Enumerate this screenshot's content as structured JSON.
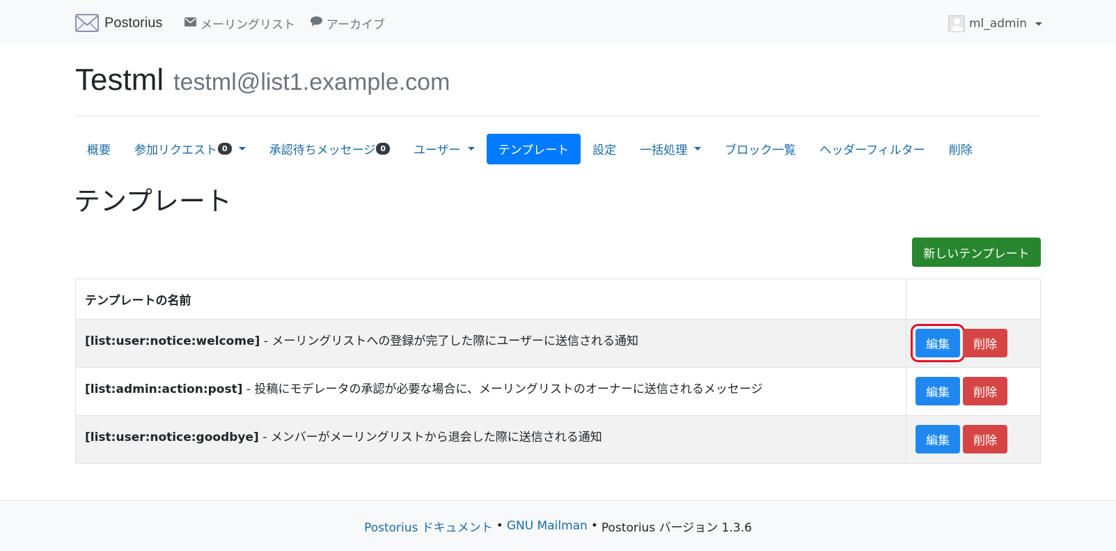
{
  "navbar": {
    "brand": "Postorius",
    "mailing_lists": "メーリングリスト",
    "archives": "アーカイブ",
    "user": "ml_admin"
  },
  "list": {
    "name": "Testml",
    "address": "testml@list1.example.com"
  },
  "tabs": {
    "overview": "概要",
    "subscription_requests": "参加リクエスト",
    "subscription_requests_count": "0",
    "held_messages": "承認待ちメッセージ",
    "held_messages_count": "0",
    "users": "ユーザー",
    "templates": "テンプレート",
    "settings": "設定",
    "mass_operations": "一括処理",
    "bans": "ブロック一覧",
    "header_filters": "ヘッダーフィルター",
    "delete": "削除"
  },
  "page": {
    "heading": "テンプレート",
    "new_template_button": "新しいテンプレート"
  },
  "table": {
    "header_name": "テンプレートの名前",
    "header_actions": "",
    "edit_label": "編集",
    "delete_label": "削除",
    "rows": [
      {
        "code": "[list:user:notice:welcome]",
        "description": " - メーリングリストへの登録が完了した際にユーザーに送信される通知"
      },
      {
        "code": "[list:admin:action:post]",
        "description": " - 投稿にモデレータの承認が必要な場合に、メーリングリストのオーナーに送信されるメッセージ"
      },
      {
        "code": "[list:user:notice:goodbye]",
        "description": " - メンバーがメーリングリストから退会した際に送信される通知"
      }
    ]
  },
  "footer": {
    "docs_link": "Postorius ドキュメント",
    "sep": "•",
    "mailman_link": "GNU Mailman",
    "version_text": "Postorius バージョン 1.3.6"
  },
  "colors": {
    "primary": "#007bff",
    "success": "#28872e",
    "danger": "#d64545",
    "link": "#1a6ca8",
    "highlight": "#e0102a"
  }
}
